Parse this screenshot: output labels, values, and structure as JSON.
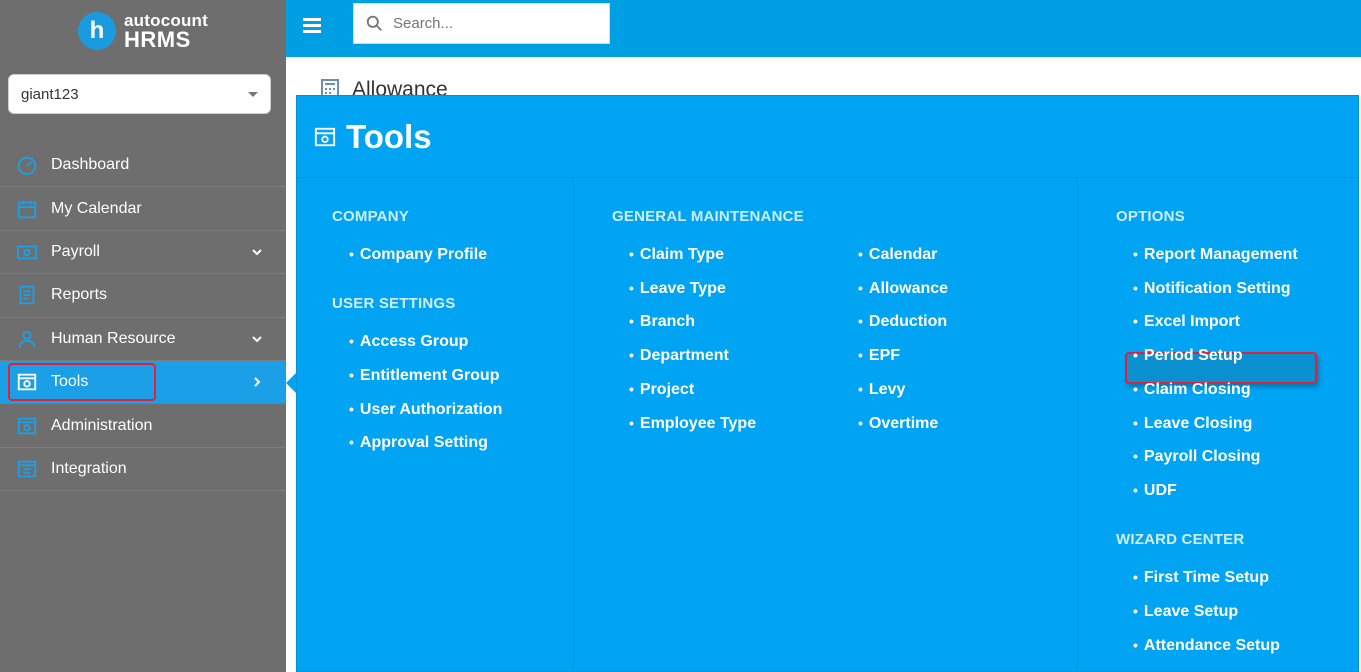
{
  "brand": {
    "small": "autocount",
    "big": "HRMS",
    "mark": "h"
  },
  "company_select": {
    "value": "giant123"
  },
  "sidebar": {
    "items": [
      {
        "label": "Dashboard",
        "icon": "gauge-icon"
      },
      {
        "label": "My Calendar",
        "icon": "calendar-icon"
      },
      {
        "label": "Payroll",
        "icon": "money-icon",
        "expandable": true
      },
      {
        "label": "Reports",
        "icon": "report-icon"
      },
      {
        "label": "Human Resource",
        "icon": "people-icon",
        "expandable": true
      },
      {
        "label": "Tools",
        "icon": "tools-icon",
        "active": true
      },
      {
        "label": "Administration",
        "icon": "admin-icon"
      },
      {
        "label": "Integration",
        "icon": "integration-icon"
      }
    ]
  },
  "topbar": {
    "search_placeholder": "Search..."
  },
  "page": {
    "title": "Allowance"
  },
  "tools_menu": {
    "title": "Tools",
    "company": {
      "heading": "COMPANY",
      "items": [
        "Company Profile"
      ]
    },
    "user_settings": {
      "heading": "USER SETTINGS",
      "items": [
        "Access Group",
        "Entitlement Group",
        "User Authorization",
        "Approval Setting"
      ]
    },
    "general": {
      "heading": "GENERAL MAINTENANCE",
      "left": [
        "Claim Type",
        "Leave Type",
        "Branch",
        "Department",
        "Project",
        "Employee Type"
      ],
      "right": [
        "Calendar",
        "Allowance",
        "Deduction",
        "EPF",
        "Levy",
        "Overtime"
      ]
    },
    "options": {
      "heading": "OPTIONS",
      "items": [
        "Report Management",
        "Notification Setting",
        "Excel Import",
        "Period Setup",
        "Claim Closing",
        "Leave Closing",
        "Payroll Closing",
        "UDF"
      ]
    },
    "wizard": {
      "heading": "WIZARD CENTER",
      "items": [
        "First Time Setup",
        "Leave Setup",
        "Attendance Setup"
      ]
    }
  },
  "colors": {
    "accent": "#00a4f2",
    "topbar": "#009fe3",
    "sidebar": "#6e6e6e",
    "highlight": "#e0213a"
  }
}
